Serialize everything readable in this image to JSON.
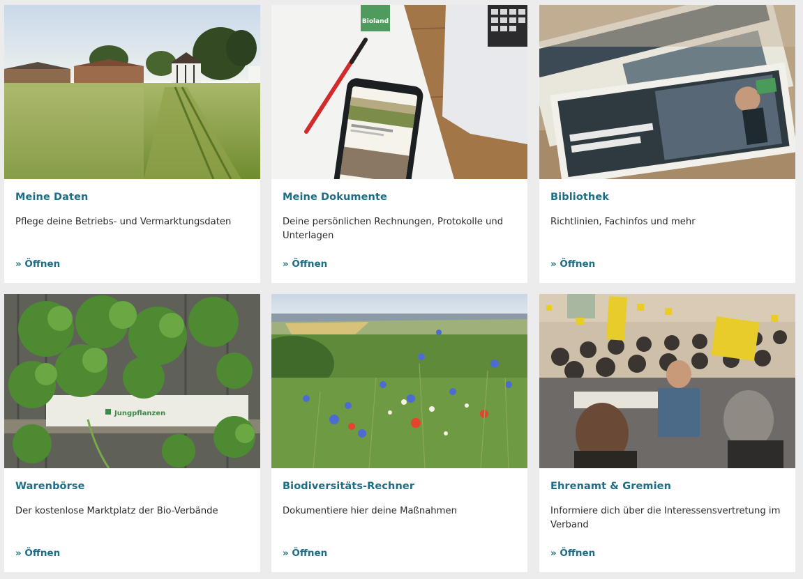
{
  "cards": [
    {
      "title": "Meine Daten",
      "description": "Pflege deine Betriebs- und Vermarktungsdaten",
      "link": "» Öffnen",
      "image": "farm-field-photo"
    },
    {
      "title": "Meine Dokumente",
      "description": "Deine persönlichen Rechnungen, Protokolle und Unterlagen",
      "link": "» Öffnen",
      "image": "documents-phone-laptop-photo",
      "image_text": "Bioland"
    },
    {
      "title": "Bibliothek",
      "description": "Richtlinien, Fachinfos und mehr",
      "link": "» Öffnen",
      "image": "magazines-photo"
    },
    {
      "title": "Warenbörse",
      "description": "Der kostenlose Marktplatz der Bio-Verbände",
      "link": "» Öffnen",
      "image": "plant-tray-photo",
      "image_text": "Jungpflanzen"
    },
    {
      "title": "Biodiversitäts-Rechner",
      "description": "Dokumentiere hier deine Maßnahmen",
      "link": "» Öffnen",
      "image": "wildflower-meadow-photo"
    },
    {
      "title": "Ehrenamt & Gremien",
      "description": "Informiere dich über die Interessensvertretung im Verband",
      "link": "» Öffnen",
      "image": "assembly-voting-photo"
    }
  ],
  "colors": {
    "accent": "#1e6d86",
    "text": "#2b2b2b",
    "background": "#ececec",
    "card": "#ffffff"
  }
}
